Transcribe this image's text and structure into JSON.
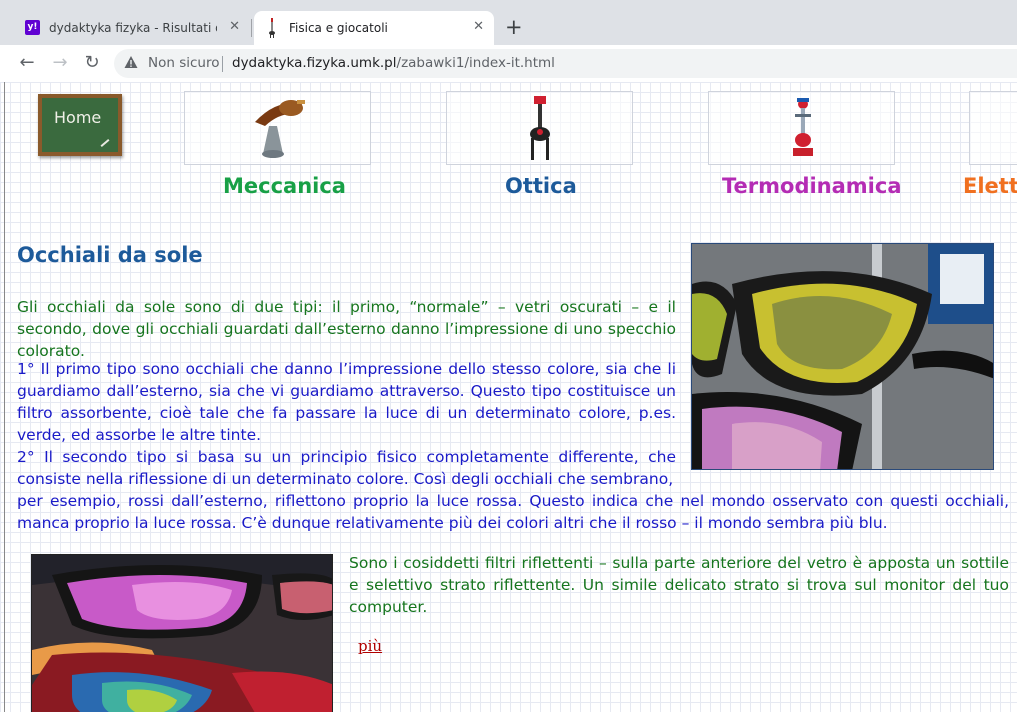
{
  "browser": {
    "tabs": [
      {
        "title": "dydaktyka fizyka - Risultati di Yah",
        "favicon": "yahoo-icon",
        "active": false
      },
      {
        "title": "Fisica e giocatoli",
        "favicon": "toy-icon",
        "active": true
      }
    ],
    "new_tab_symbol": "+",
    "security_label": "Non sicuro",
    "url_host": "dydaktyka.fizyka.umk.pl",
    "url_path": "/zabawki1/index-it.html",
    "accent_colors": {
      "yahoo": "#6001d2"
    }
  },
  "page": {
    "home_label": "Home",
    "nav": [
      {
        "label": "Meccanica",
        "color": "#18a046"
      },
      {
        "label": "Ottica",
        "color": "#1d5a9a"
      },
      {
        "label": "Termodinamica",
        "color": "#b42cb4"
      },
      {
        "label": "Elett",
        "color": "#f07020"
      }
    ],
    "title": "Occhiali da sole",
    "intro": "Gli occhiali da sole sono di due tipi: il primo, “normale” – vetri oscurati – e il secondo, dove gli occhiali guardati dall’esterno danno l’impressione di uno specchio colorato.",
    "type1_text": "1° Il primo tipo sono occhiali che danno l’impressione dello stesso colore, sia che li guardiamo dall’esterno, sia che vi guardiamo attraverso. Questo tipo costituisce un filtro assorbente, cioè tale che fa passare la luce di un determinato colore, p.es. verde, ed assorbe le altre tinte.",
    "type2_text": "2° Il secondo tipo si basa su un principio fisico completamente differente, che consiste nella riflessione di un determinato colore. Così degli occhiali che sembrano,",
    "type2_cont": "per esempio, rossi dall’esterno, riflettono proprio la luce rossa. Questo indica che nel mondo osservato con questi occhiali, manca proprio la luce rossa. C’è dunque relativamente più dei colori altri che il rosso – il mondo sembra più blu.",
    "filter_text": "Sono i cosiddetti filtri riflettenti – sulla parte anteriore del vetro è apposta un sottile e selettivo strato riflettente. Un simile delicato strato si trova sul monitor del tuo computer.",
    "more_link": "più"
  }
}
